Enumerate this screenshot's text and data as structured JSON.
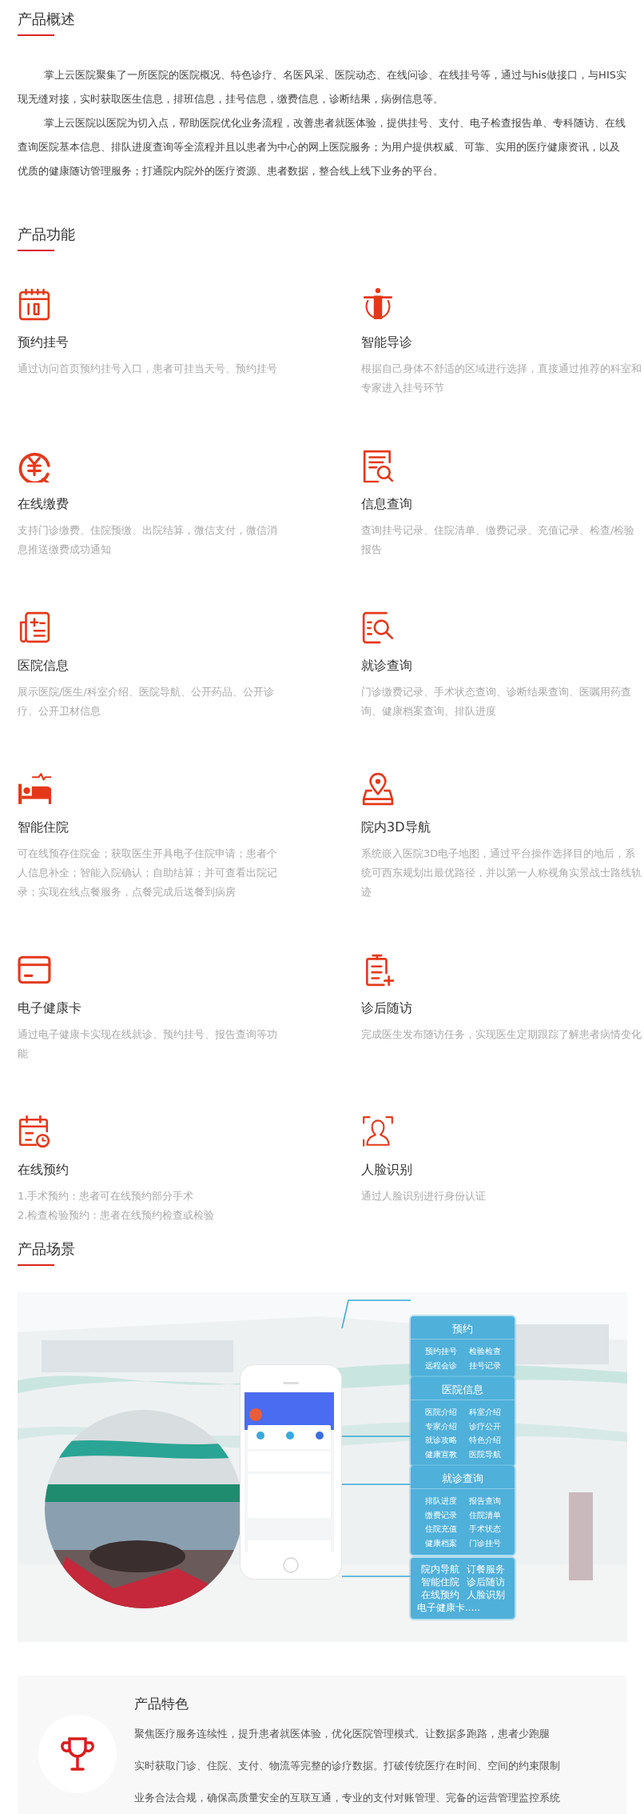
{
  "overview": {
    "title": "产品概述",
    "paragraphs": [
      "掌上云医院聚集了一所医院的医院概况、特色诊疗、名医风采、医院动态、在线问诊、在线挂号等，通过与his做接口，与HIS实现无缝对接，实时获取医生信息，排班信息，挂号信息，缴费信息，诊断结果，病例信息等。",
      "掌上云医院以医院为切入点，帮助医院优化业务流程，改善患者就医体验，提供挂号、支付、电子检查报告单、专科随访、在线查询医院基本信息、排队进度查询等全流程并且以患者为中心的网上医院服务；为用户提供权威、可靠、实用的医疗健康资讯，以及优质的健康随访管理服务；打通院内院外的医疗资源、患者数据，整合线上线下业务的平台。"
    ]
  },
  "features": {
    "title": "产品功能",
    "items": [
      {
        "kind": "calendar",
        "title": "预约挂号",
        "description": [
          "通过访问首页预约挂号入口，患者可挂当天号、预约挂号"
        ]
      },
      {
        "kind": "body",
        "title": "智能导诊",
        "description": [
          "根据自己身体不舒适的区域进行选择，直接通过推荐的科室和专家进入挂号环节"
        ]
      },
      {
        "kind": "payment",
        "title": "在线缴费",
        "description": [
          "支持门诊缴费、住院预缴、出院结算，微信支付，微信消息推送缴费成功通知"
        ]
      },
      {
        "kind": "document-search",
        "title": "信息查询",
        "description": [
          "查询挂号记录、住院清单、缴费记录、充值记录、检查/检验报告"
        ]
      },
      {
        "kind": "medical-record",
        "title": "医院信息",
        "description": [
          "展示医院/医生/科室介绍、医院导航、公开药品、公开诊疗、公开卫材信息"
        ]
      },
      {
        "kind": "list-search",
        "title": "就诊查询",
        "description": [
          "门诊缴费记录、手术状态查询、诊断结果查询、医嘱用药查询、健康档案查询、排队进度"
        ]
      },
      {
        "kind": "bed",
        "title": "智能住院",
        "description": [
          "可在线预存住院金；获取医生开具电子住院申请；患者个人信息补全；智能入院确认；自助结算；并可查看出院记录；实现在线点餐服务，点餐完成后送餐到病房"
        ]
      },
      {
        "kind": "map-pin",
        "title": "院内3D导航",
        "description": [
          "系统嵌入医院3D电子地图，通过平台操作选择目的地后，系统可西东规划出最优路径，并以第一人称视角实景战士路线轨迹"
        ]
      },
      {
        "kind": "card",
        "title": "电子健康卡",
        "description": [
          "通过电子健康卡实现在线就诊、预约挂号、报告查询等功能"
        ]
      },
      {
        "kind": "clipboard",
        "title": "诊后随访",
        "description": [
          "完成医生发布随访任务，实现医生定期跟踪了解患者病情变化"
        ]
      },
      {
        "kind": "calendar-clock",
        "title": "在线预约",
        "description": [
          "1.手术预约：患者可在线预约部分手术",
          "2.检查检验预约：患者在线预约检查或检验"
        ]
      },
      {
        "kind": "face",
        "title": "人脸识别",
        "description": [
          "通过人脸识别进行身份认证"
        ]
      }
    ]
  },
  "scene": {
    "title": "产品场景",
    "panels": [
      {
        "heading": "预约",
        "items": [
          "预约挂号",
          "检验检查",
          "远程会诊",
          "挂号记录"
        ]
      },
      {
        "heading": "医院信息",
        "items": [
          "医院介绍",
          "科室介绍",
          "专家介绍",
          "诊疗公开",
          "就诊攻略",
          "特色介绍",
          "健康宣教",
          "医院导航"
        ]
      },
      {
        "heading": "就诊查询",
        "items": [
          "排队进度",
          "报告查询",
          "缴费记录",
          "住院清单",
          "住院充值",
          "手术状态",
          "健康档案",
          "门诊挂号"
        ]
      },
      {
        "items": [
          "院内导航",
          "订餐服务",
          "智能住院",
          "诊后随访",
          "在线预约",
          "人脸识别",
          "电子健康卡....."
        ]
      }
    ]
  },
  "highlights": {
    "title": "产品特色",
    "lines": [
      "聚焦医疗服务连续性，提升患者就医体验，优化医院管理模式。让数据多跑路，患者少跑腿",
      "实时获取门诊、住院、支付、物流等完整的诊疗数据。打破传统医疗在时间、空间的约束限制",
      "业务合法合规，确保高质量安全的互联互通，专业的支付对账管理、完备的运营管理监控系统"
    ]
  }
}
